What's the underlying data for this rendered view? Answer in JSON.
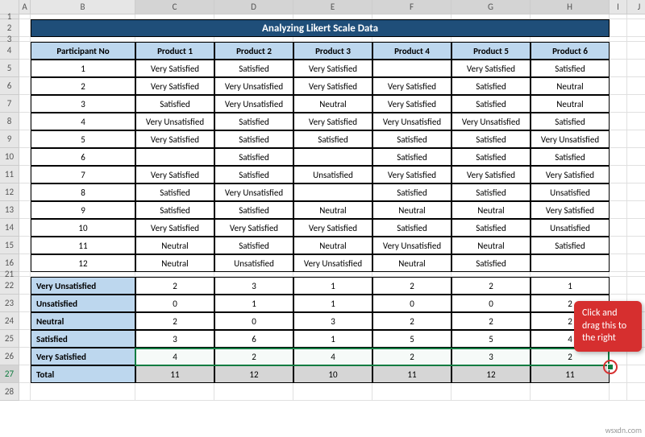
{
  "cols": [
    "A",
    "B",
    "C",
    "D",
    "E",
    "F",
    "G",
    "H",
    "I",
    "J"
  ],
  "rows_upper": [
    "1",
    "2",
    "3",
    "4",
    "5",
    "6",
    "7",
    "8",
    "9",
    "10",
    "11",
    "12",
    "13",
    "14",
    "15",
    "16"
  ],
  "rows_lower": [
    "21",
    "22",
    "23",
    "24",
    "25",
    "26",
    "27",
    "28"
  ],
  "title": "Analyzing Likert Scale Data",
  "headers": [
    "Participant No",
    "Product 1",
    "Product 2",
    "Product 3",
    "Product 4",
    "Product 5",
    "Product 6"
  ],
  "data": [
    [
      "1",
      "Very Satisfied",
      "Satisfied",
      "Very Satisfied",
      "",
      "Very Satisfied",
      "Satisfied"
    ],
    [
      "2",
      "Very Satisfied",
      "Very Unsatisfied",
      "Very Satisfied",
      "Very Satisfied",
      "Satisfied",
      "Neutral"
    ],
    [
      "3",
      "Satisfied",
      "Very Unsatisfied",
      "Neutral",
      "Very Satisfied",
      "Satisfied",
      "Neutral"
    ],
    [
      "4",
      "Very Unsatisfied",
      "Satisfied",
      "Very Satisfied",
      "Very Unsatisfied",
      "Very Unsatisfied",
      "Satisfied"
    ],
    [
      "5",
      "Very Satisfied",
      "Satisfied",
      "Satisfied",
      "Satisfied",
      "Satisfied",
      "Very Unsatisfied"
    ],
    [
      "6",
      "",
      "Satisfied",
      "",
      "Satisfied",
      "Satisfied",
      "Satisfied"
    ],
    [
      "7",
      "Very Satisfied",
      "Satisfied",
      "Unsatisfied",
      "Very Satisfied",
      "Very Satisfied",
      "Very Satisfied"
    ],
    [
      "8",
      "Satisfied",
      "Very Unsatisfied",
      "",
      "Satisfied",
      "Satisfied",
      "Unsatisfied"
    ],
    [
      "9",
      "Satisfied",
      "Satisfied",
      "Neutral",
      "Neutral",
      "Neutral",
      "Very Satisfied"
    ],
    [
      "10",
      "Very Satisfied",
      "Very Satisfied",
      "Very Satisfied",
      "Satisfied",
      "Satisfied",
      "Unsatisfied"
    ],
    [
      "11",
      "Neutral",
      "Satisfied",
      "Neutral",
      "Very Unsatisfied",
      "Neutral",
      "Satisfied"
    ],
    [
      "12",
      "Neutral",
      "Unsatisfied",
      "Very Unsatisfied",
      "Neutral",
      "Satisfied",
      ""
    ]
  ],
  "summary_labels": [
    "Very Unsatisfied",
    "Unsatisfied",
    "Neutral",
    "Satisfied",
    "Very Satisfied",
    "Total"
  ],
  "summary": [
    [
      "2",
      "3",
      "1",
      "2",
      "2",
      "1"
    ],
    [
      "0",
      "1",
      "1",
      "0",
      "0",
      "2"
    ],
    [
      "2",
      "0",
      "3",
      "2",
      "2",
      "2"
    ],
    [
      "3",
      "6",
      "1",
      "5",
      "5",
      "4"
    ],
    [
      "4",
      "2",
      "4",
      "2",
      "3",
      "2"
    ],
    [
      "11",
      "12",
      "10",
      "11",
      "12",
      "11"
    ]
  ],
  "callout": "Click and drag this to the right",
  "watermark": "wsxdn.com",
  "chart_data": {
    "type": "table",
    "title": "Likert Scale Summary Counts by Product",
    "categories": [
      "Product 1",
      "Product 2",
      "Product 3",
      "Product 4",
      "Product 5",
      "Product 6"
    ],
    "series": [
      {
        "name": "Very Unsatisfied",
        "values": [
          2,
          3,
          1,
          2,
          2,
          1
        ]
      },
      {
        "name": "Unsatisfied",
        "values": [
          0,
          1,
          1,
          0,
          0,
          2
        ]
      },
      {
        "name": "Neutral",
        "values": [
          2,
          0,
          3,
          2,
          2,
          2
        ]
      },
      {
        "name": "Satisfied",
        "values": [
          3,
          6,
          1,
          5,
          5,
          4
        ]
      },
      {
        "name": "Very Satisfied",
        "values": [
          4,
          2,
          4,
          2,
          3,
          2
        ]
      },
      {
        "name": "Total",
        "values": [
          11,
          12,
          10,
          11,
          12,
          11
        ]
      }
    ]
  }
}
